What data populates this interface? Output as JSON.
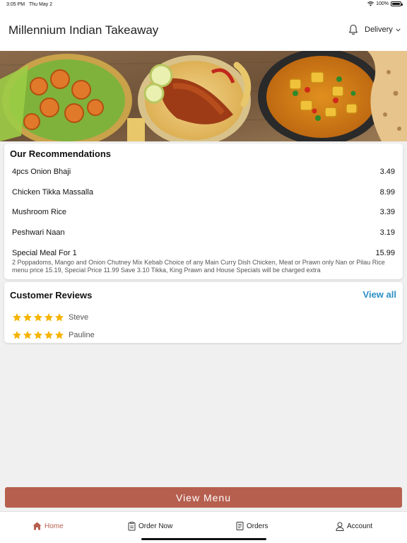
{
  "status_bar": {
    "time": "3:05 PM",
    "date": "Thu May 2",
    "battery": "100%"
  },
  "header": {
    "title": "Millennium Indian Takeaway",
    "delivery_label": "Delivery"
  },
  "recommendations": {
    "title": "Our Recommendations",
    "items": [
      {
        "name": "4pcs Onion Bhaji",
        "price": "3.49"
      },
      {
        "name": "Chicken Tikka Massalla",
        "price": "8.99"
      },
      {
        "name": "Mushroom Rice",
        "price": "3.39"
      },
      {
        "name": "Peshwari Naan",
        "price": "3.19"
      },
      {
        "name": "Special Meal For 1",
        "price": "15.99"
      }
    ],
    "special_description": "2 Poppadoms, Mango and Onion Chutney Mix Kebab Choice of any Main Curry Dish Chicken, Meat or Prawn only Nan or Pilau Rice menu price 15.19, Special Price 11.99 Save 3.10 Tikka, King Prawn and House Specials will be charged extra"
  },
  "reviews": {
    "title": "Customer Reviews",
    "view_all": "View all",
    "items": [
      {
        "name": "Steve",
        "rating": 5
      },
      {
        "name": "Pauline",
        "rating": 5
      }
    ]
  },
  "view_menu_label": "View Menu",
  "tabs": [
    {
      "label": "Home",
      "icon": "home-icon",
      "active": true
    },
    {
      "label": "Order Now",
      "icon": "order-icon",
      "active": false
    },
    {
      "label": "Orders",
      "icon": "receipt-icon",
      "active": false
    },
    {
      "label": "Account",
      "icon": "user-icon",
      "active": false
    }
  ],
  "colors": {
    "accent": "#b65f4f",
    "link": "#2b8fc4",
    "star": "#f5b400"
  }
}
